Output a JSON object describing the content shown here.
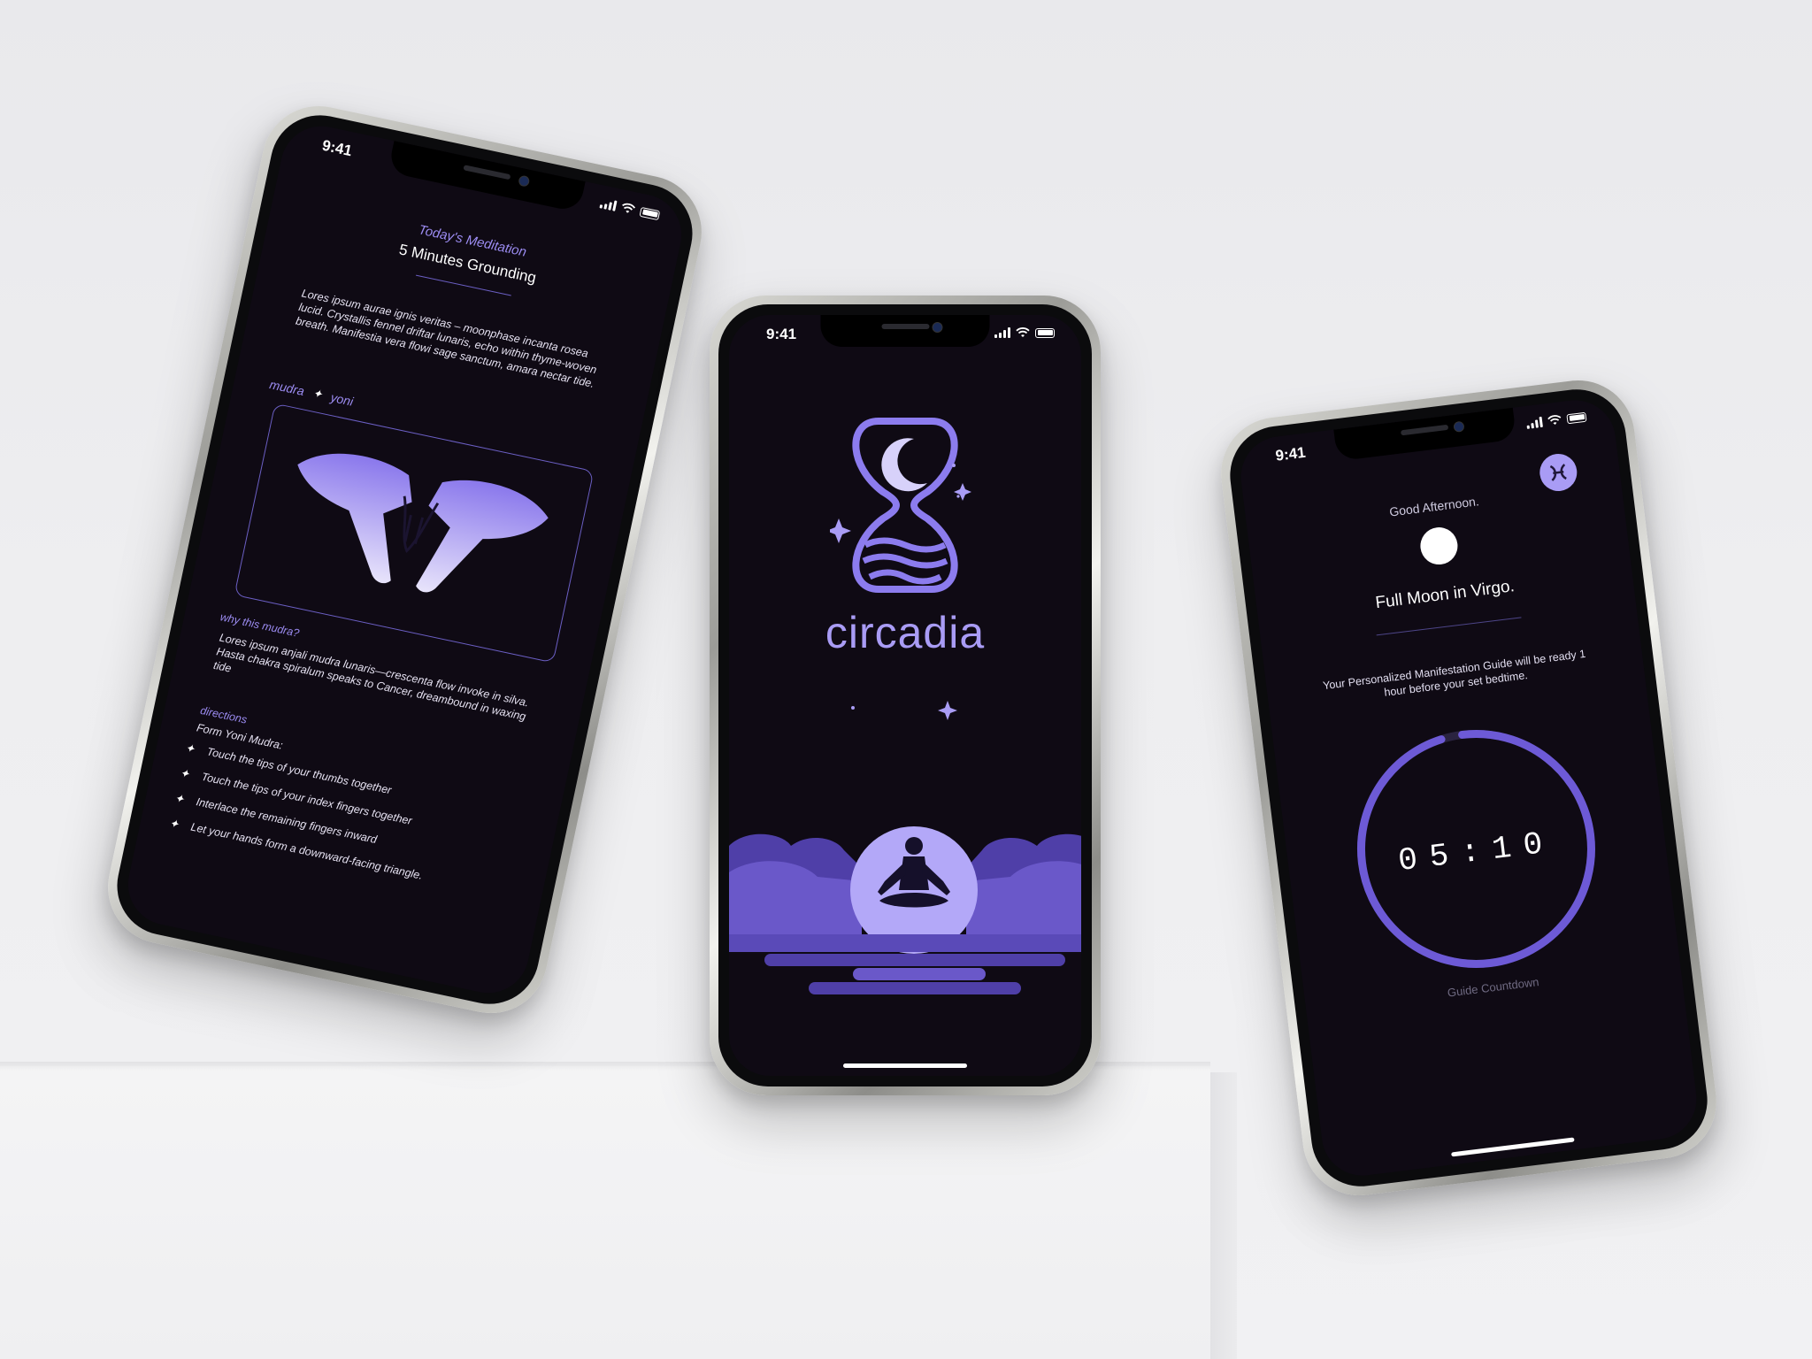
{
  "status": {
    "time": "9:41"
  },
  "left_screen": {
    "kicker": "Today's Meditation",
    "title": "5 Minutes Grounding",
    "description": "Lores ipsum aurae ignis veritas – moonphase incanta rosea lucid. Crystallis fennel driftar lunaris, echo within thyme-woven breath. Manifestia vera flowi sage sanctum, amara nectar tide.",
    "tags": [
      "mudra",
      "yoni"
    ],
    "tag_separator": "✦",
    "why_label": "why this mudra?",
    "why_text": "Lores ipsum anjali mudra lunaris—crescenta flow invoke in silva. Hasta chakra spiralum speaks to Cancer, dreambound in waxing tide",
    "directions_label": "directions",
    "directions_intro": "Form Yoni Mudra:",
    "directions": [
      "Touch the tips of your thumbs together",
      "Touch the tips of your index fingers together",
      "Interlace the remaining fingers inward",
      "Let your hands form a downward-facing triangle."
    ]
  },
  "center_screen": {
    "app_name": "circadia",
    "logo_icon": "hourglass-moon-icon",
    "illustration": "meditating-figure-moon-clouds"
  },
  "right_screen": {
    "greeting": "Good Afternoon.",
    "moon_phase": "Full Moon in Virgo.",
    "zodiac_icon": "pisces-icon",
    "guide_text": "Your Personalized Manifestation Guide will be ready 1 hour before your set bedtime.",
    "countdown": "05:10",
    "countdown_label": "Guide Countdown",
    "progress_fraction": 0.97
  },
  "colors": {
    "accent": "#9c8cf2",
    "screen_bg": "#0f0a14",
    "cloud_dark": "#4f3fa8",
    "cloud_mid": "#6a58c9"
  }
}
